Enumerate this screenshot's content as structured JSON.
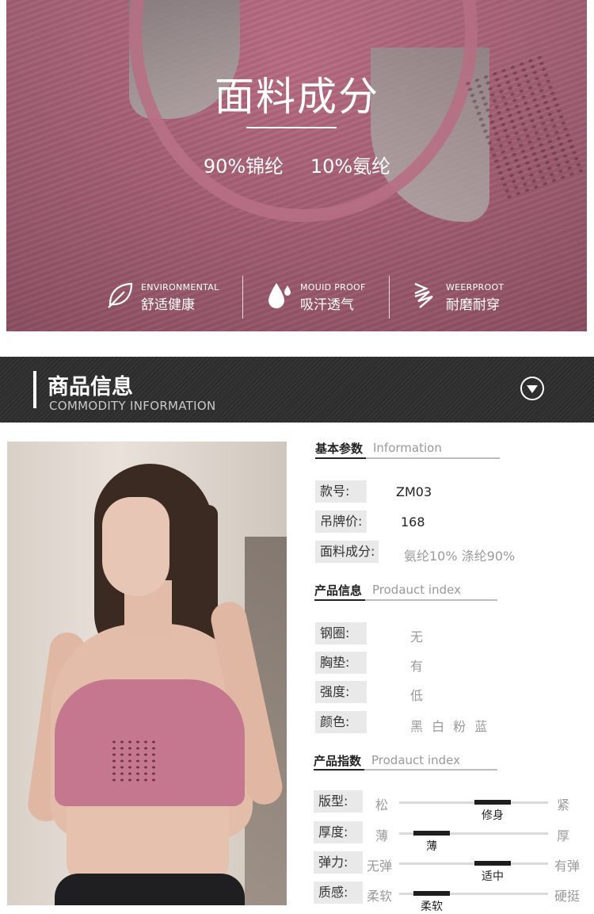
{
  "hero": {
    "title": "面料成分",
    "composition": [
      "90%锦纶",
      "10%氨纶"
    ],
    "features": [
      {
        "en": "ENVIRONMENTAL",
        "cn": "舒适健康",
        "icon": "leaf-icon"
      },
      {
        "en": "MOUID PROOF",
        "cn": "吸汗透气",
        "icon": "water-drop-icon"
      },
      {
        "en": "WEERPROOT",
        "cn": "耐磨耐穿",
        "icon": "wear-arrows-icon"
      }
    ]
  },
  "section_header": {
    "title": "商品信息",
    "subtitle": "COMMODITY INFORMATION",
    "icon": "chevron-down-circle-icon"
  },
  "basic": {
    "title_cn": "基本参数",
    "title_en": "Information",
    "rows": [
      {
        "label": "款号:",
        "value": "ZM03"
      },
      {
        "label": "吊牌价:",
        "value": "168"
      },
      {
        "label": "面料成分:",
        "value": "氨纶10% 涤纶90%"
      }
    ]
  },
  "product_info": {
    "title_cn": "产品信息",
    "title_en": "Prodauct index",
    "rows": [
      {
        "label": "钢圈:",
        "value": "无"
      },
      {
        "label": "胸垫:",
        "value": "有"
      },
      {
        "label": "强度:",
        "value": "低"
      },
      {
        "label": "颜色:",
        "value": "黑 白 粉 蓝"
      }
    ]
  },
  "product_index": {
    "title_cn": "产品指数",
    "title_en": "Prodauct index",
    "scales": [
      {
        "label": "版型:",
        "left": "松",
        "right": "紧",
        "selected": "修身",
        "position": 0.5
      },
      {
        "label": "厚度:",
        "left": "薄",
        "right": "厚",
        "selected": "薄",
        "position": 0.25
      },
      {
        "label": "弹力:",
        "left": "无弹",
        "right": "有弹",
        "selected": "适中",
        "position": 0.5
      },
      {
        "label": "质感:",
        "left": "柔软",
        "right": "硬挺",
        "selected": "柔软",
        "position": 0.25
      }
    ]
  },
  "colors": {
    "hero_pink": "#b0657c",
    "band_dark": "#2f2f2f",
    "label_bg": "#e9e9e9",
    "knob": "#1e1e1e"
  }
}
